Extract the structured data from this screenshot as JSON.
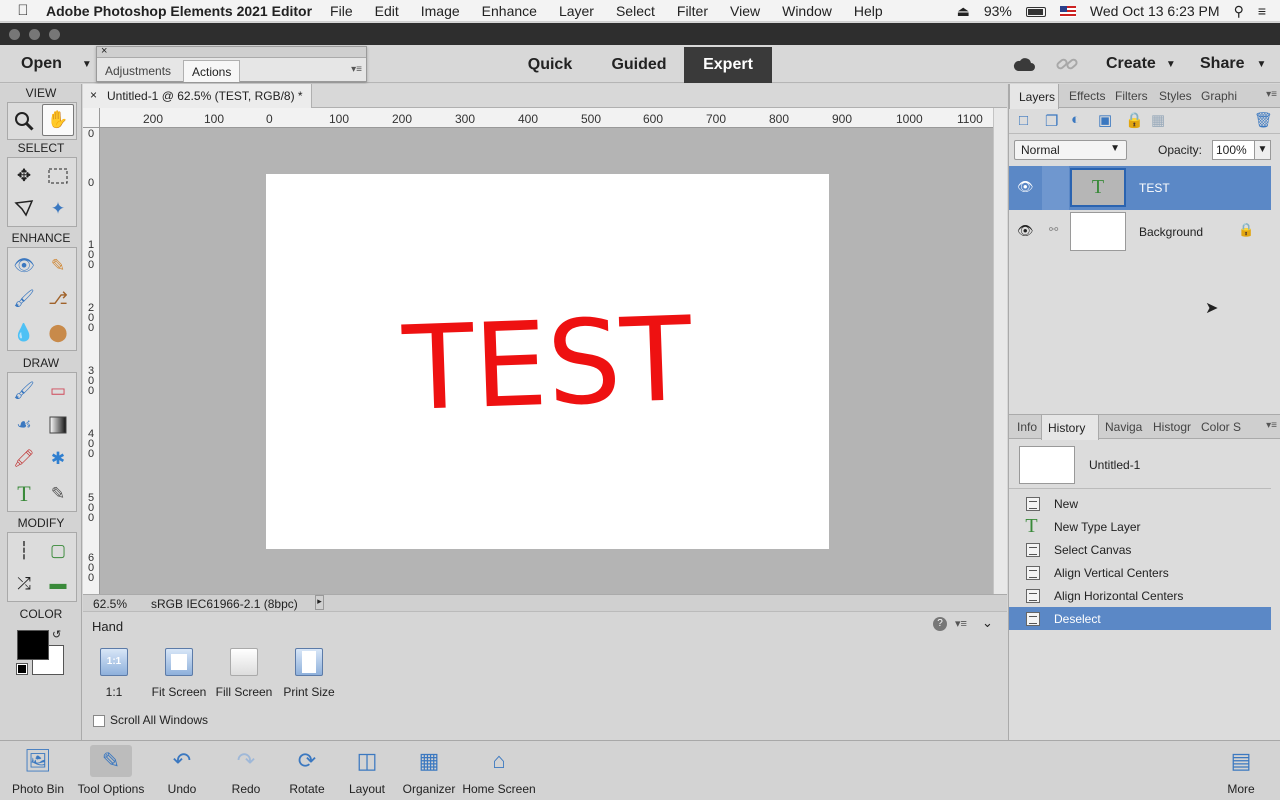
{
  "menubar": {
    "app_name": "Adobe Photoshop Elements 2021 Editor",
    "items": [
      "File",
      "Edit",
      "Image",
      "Enhance",
      "Layer",
      "Select",
      "Filter",
      "View",
      "Window",
      "Help"
    ],
    "battery": "93%",
    "clock": "Wed Oct 13  6:23 PM"
  },
  "topbar": {
    "open": "Open",
    "modes": [
      "Quick",
      "Guided",
      "Expert"
    ],
    "active_mode": "Expert",
    "create": "Create",
    "share": "Share"
  },
  "float_panel": {
    "tabs": [
      "Adjustments",
      "Actions"
    ],
    "active_tab": "Actions"
  },
  "toolbox": {
    "sections": [
      "VIEW",
      "SELECT",
      "ENHANCE",
      "DRAW",
      "MODIFY",
      "COLOR"
    ]
  },
  "document": {
    "tab_title": "Untitled-1 @ 62.5% (TEST, RGB/8) *",
    "canvas_text": "TEST",
    "canvas_text_color": "#ee1111",
    "ruler_top": [
      "200",
      "100",
      "0",
      "100",
      "200",
      "300",
      "400",
      "500",
      "600",
      "700",
      "800",
      "900",
      "1000",
      "1100"
    ],
    "ruler_left": [
      "0",
      "0",
      "1 0 0",
      "2 0 0",
      "3 0 0",
      "4 0 0",
      "5 0 0",
      "6 0 0"
    ],
    "zoom": "62.5%",
    "color_profile": "sRGB IEC61966-2.1 (8bpc)"
  },
  "tool_options": {
    "tool_name": "Hand",
    "buttons": [
      "1:1",
      "Fit Screen",
      "Fill Screen",
      "Print Size"
    ],
    "icon_text_1to1": "1:1",
    "scroll_all_windows": "Scroll All Windows"
  },
  "layers_panel": {
    "tabs": [
      "Layers",
      "Effects",
      "Filters",
      "Styles",
      "Graphi"
    ],
    "blend_mode": "Normal",
    "opacity_label": "Opacity:",
    "opacity_value": "100%",
    "layers": [
      "TEST",
      "Background"
    ],
    "text_layer_glyph": "T"
  },
  "history_panel": {
    "tabs": [
      "Info",
      "History",
      "Naviga",
      "Histogr",
      "Color S"
    ],
    "snapshot": "Untitled-1",
    "items": [
      "New",
      "New Type Layer",
      "Select Canvas",
      "Align Vertical Centers",
      "Align Horizontal Centers",
      "Deselect"
    ],
    "selected": "Deselect",
    "type_layer_glyph": "T"
  },
  "taskbar": {
    "items": [
      "Photo Bin",
      "Tool Options",
      "Undo",
      "Redo",
      "Rotate",
      "Layout",
      "Organizer",
      "Home Screen"
    ],
    "more": "More"
  },
  "colors": {
    "accent_selection": "#5b88c6",
    "foreground": "#000000",
    "background": "#ffffff"
  }
}
